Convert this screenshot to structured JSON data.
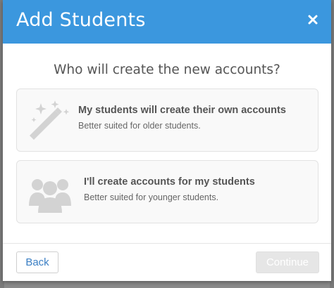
{
  "modal": {
    "title": "Add Students",
    "close_icon": "close-icon",
    "question": "Who will create the new accounts?"
  },
  "options": [
    {
      "icon": "magic-wand-icon",
      "title": "My students will create their own accounts",
      "subtitle": "Better suited for older students."
    },
    {
      "icon": "people-group-icon",
      "title": "I'll create accounts for my students",
      "subtitle": "Better suited for younger students."
    }
  ],
  "footer": {
    "back_label": "Back",
    "continue_label": "Continue",
    "continue_enabled": false
  },
  "colors": {
    "header": "#3b97de",
    "icon": "#d3d3d3",
    "back_text": "#3b7fc4",
    "continue_disabled_bg": "#e6e6e6"
  }
}
